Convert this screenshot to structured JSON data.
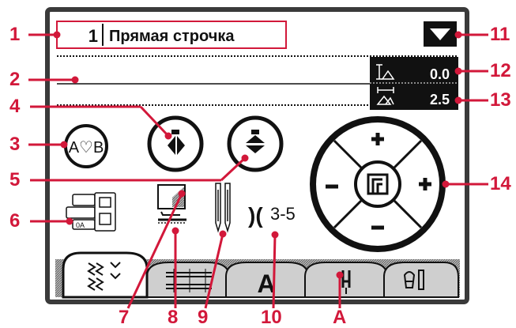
{
  "colors": {
    "accent": "#d2183a",
    "screen_bg": "#ffffff",
    "lcd_dark": "#111111",
    "frame": "#3a3a3a"
  },
  "header": {
    "stitch_number": "1",
    "stitch_name": "Прямая строчка",
    "dropdown_icon": "triangle-down-icon"
  },
  "settings": {
    "stitch_width_value": "0.0",
    "stitch_length_value": "2.5",
    "stitch_width_icon": "stitch-width-icon",
    "stitch_length_icon": "stitch-length-icon"
  },
  "indicators": {
    "needle_count": "3-5"
  },
  "tabs": [
    {
      "name": "stitch-programs-tab",
      "icon": "stitch-programs-icon"
    },
    {
      "name": "sequence-tab",
      "icon": "sequence-icon"
    },
    {
      "name": "font-tab",
      "icon": "letter-a-icon"
    },
    {
      "name": "needle-tab",
      "icon": "needle-icon"
    },
    {
      "name": "settings-tab",
      "icon": "settings-icon"
    }
  ],
  "callouts": {
    "c1": "1",
    "c2": "2",
    "c3": "3",
    "c4": "4",
    "c5": "5",
    "c6": "6",
    "c7": "7",
    "c8": "8",
    "c9": "9",
    "c10": "10",
    "c11": "11",
    "c12": "12",
    "c13": "13",
    "c14": "14",
    "cA": "A"
  }
}
